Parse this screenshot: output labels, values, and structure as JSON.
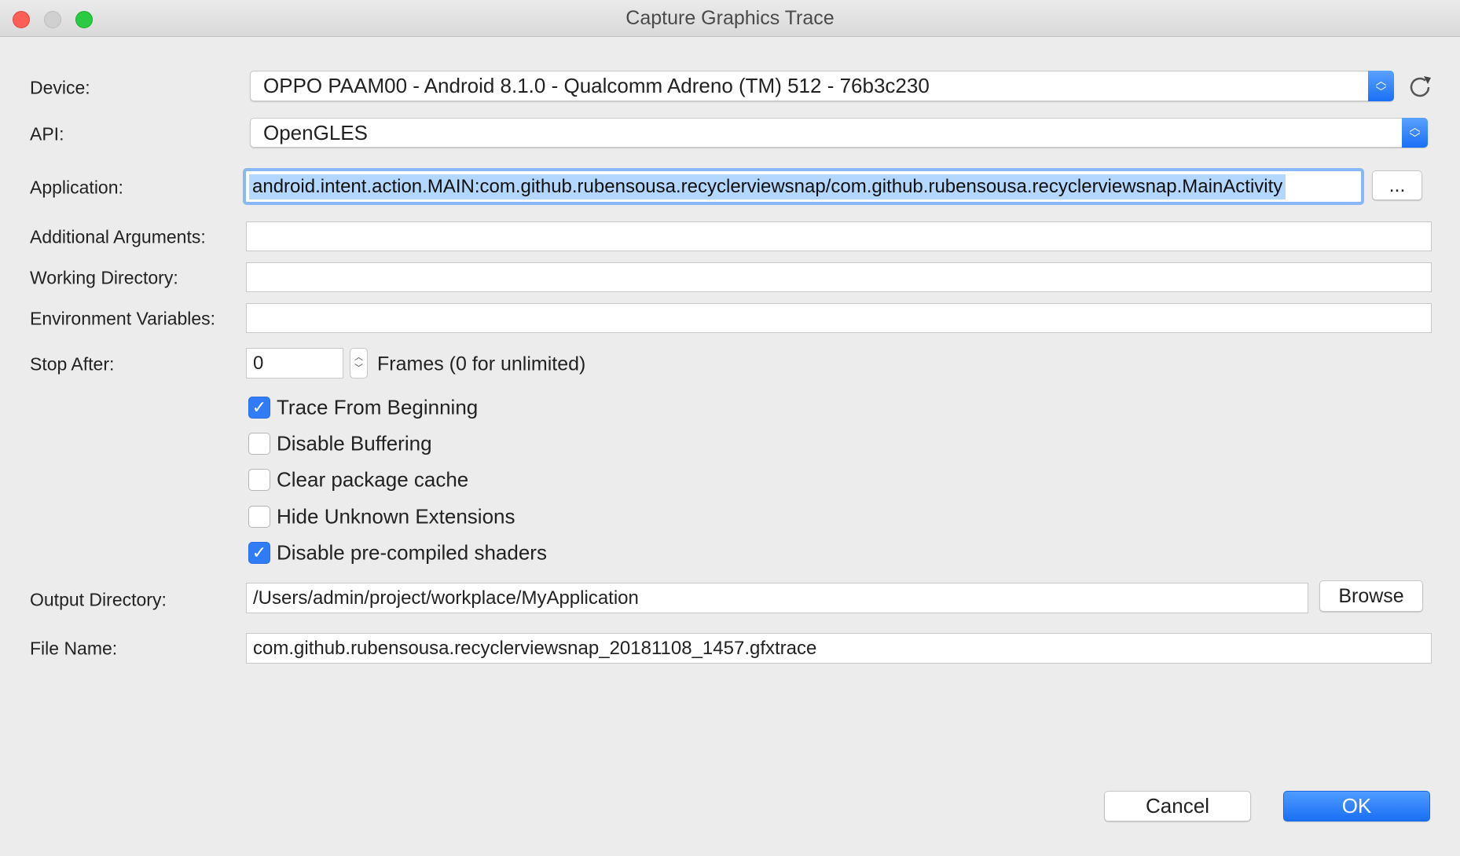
{
  "window": {
    "title": "Capture Graphics Trace"
  },
  "form": {
    "device": {
      "label": "Device:",
      "value": "OPPO PAAM00 - Android 8.1.0 - Qualcomm Adreno (TM) 512 - 76b3c230"
    },
    "api": {
      "label": "API:",
      "value": "OpenGLES"
    },
    "application": {
      "label": "Application:",
      "value": "android.intent.action.MAIN:com.github.rubensousa.recyclerviewsnap/com.github.rubensousa.recyclerviewsnap.MainActivity",
      "browse_label": "..."
    },
    "additional_arguments": {
      "label": "Additional Arguments:",
      "value": ""
    },
    "working_directory": {
      "label": "Working Directory:",
      "value": ""
    },
    "environment_variables": {
      "label": "Environment Variables:",
      "value": ""
    },
    "stop_after": {
      "label": "Stop After:",
      "value": "0",
      "suffix": "Frames (0 for unlimited)"
    },
    "checkboxes": [
      {
        "label": "Trace From Beginning",
        "checked": true
      },
      {
        "label": "Disable Buffering",
        "checked": false
      },
      {
        "label": "Clear package cache",
        "checked": false
      },
      {
        "label": "Hide Unknown Extensions",
        "checked": false
      },
      {
        "label": "Disable pre-compiled shaders",
        "checked": true
      }
    ],
    "output_directory": {
      "label": "Output Directory:",
      "value": "/Users/admin/project/workplace/MyApplication",
      "browse_label": "Browse"
    },
    "file_name": {
      "label": "File Name:",
      "value": "com.github.rubensousa.recyclerviewsnap_20181108_1457.gfxtrace"
    }
  },
  "footer": {
    "cancel_label": "Cancel",
    "ok_label": "OK"
  },
  "colors": {
    "accent": "#1a6ff5",
    "selection": "#b3d7ff"
  }
}
